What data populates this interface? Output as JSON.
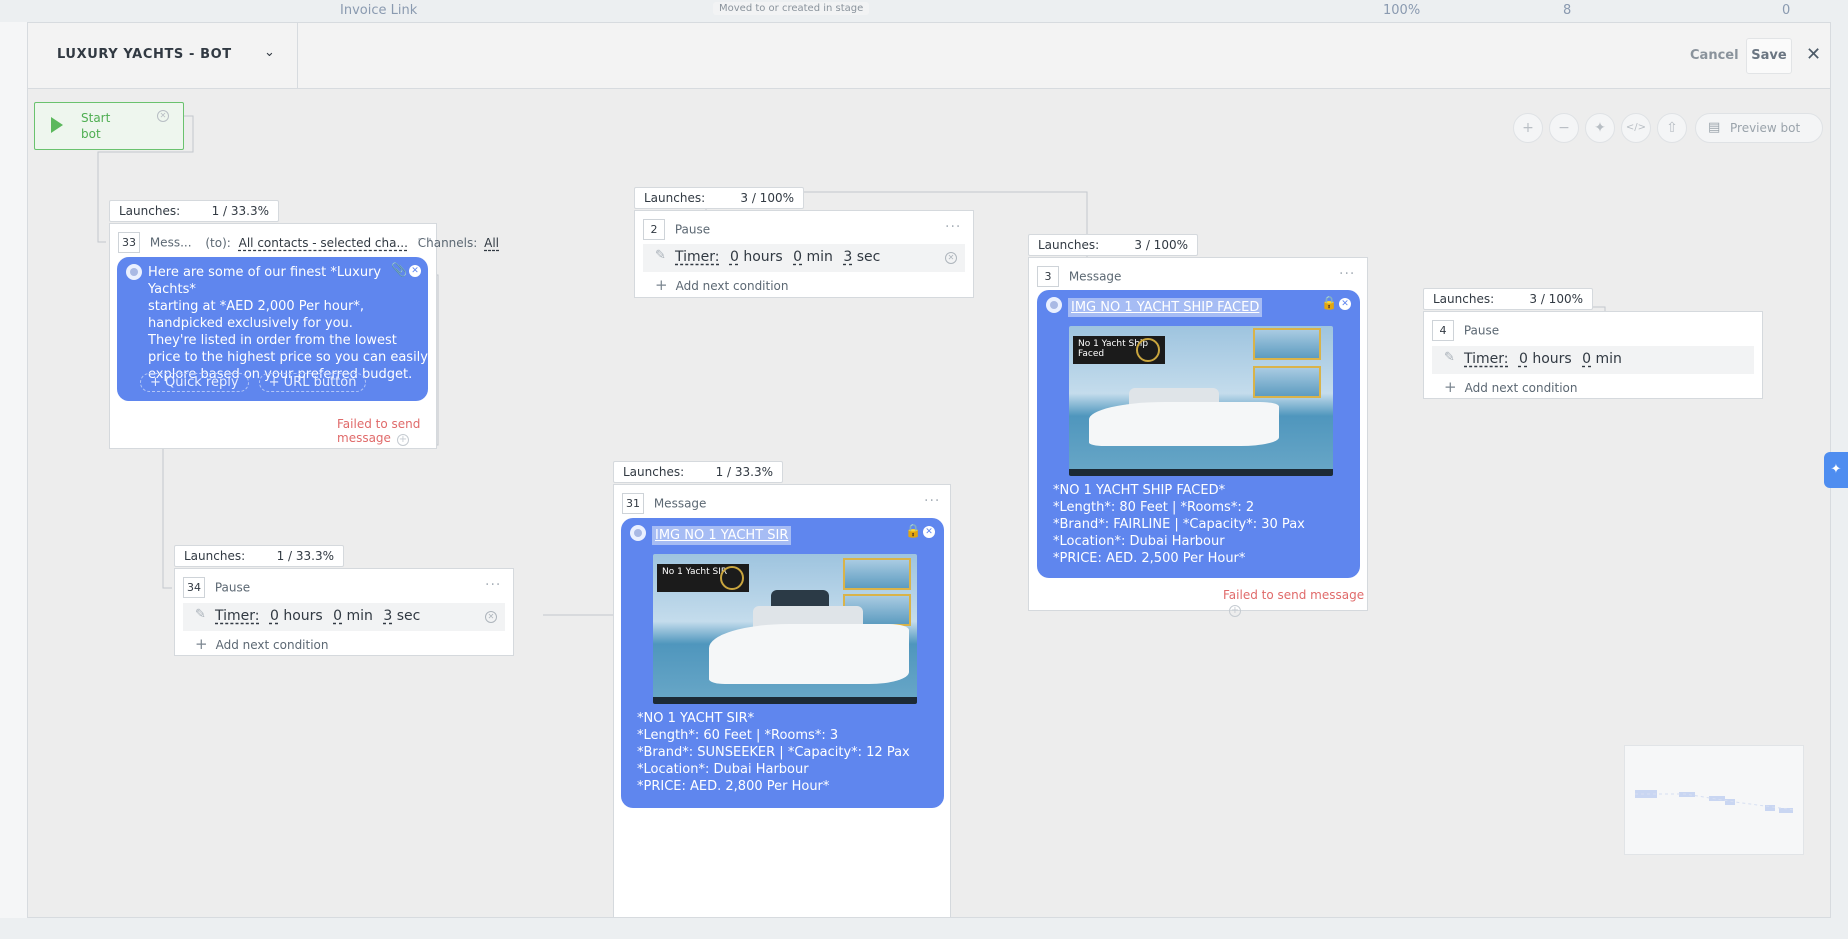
{
  "background": {
    "row_title": "Invoice Link",
    "row_badge": "Moved to or created in stage",
    "row_percent": "100%",
    "row_count_a": "8",
    "row_count_b": "0"
  },
  "header": {
    "title": "LUXURY YACHTS - BOT",
    "cancel_label": "Cancel",
    "save_label": "Save"
  },
  "toolbar": {
    "preview_label": "Preview bot"
  },
  "start": {
    "label_line1": "Start",
    "label_line2": "bot"
  },
  "nodes": {
    "n33": {
      "launches_label": "Launches:",
      "launches_value": "1 / 33.3%",
      "number": "33",
      "type": "Mess...",
      "to_label": "(to):",
      "to_value": "All contacts - selected cha...",
      "channels_label": "Channels:",
      "channels_value": "All",
      "text": "Here are some of our finest *Luxury Yachts*\nstarting at *AED 2,000 Per hour*,\nhandpicked exclusively for you.\nThey're listed in order from the lowest\nprice to the highest price so you can easily\nexplore based on your preferred budget.",
      "quick_reply": "+ Quick reply",
      "url_button": "+ URL button",
      "status": "Failed to send message"
    },
    "n34": {
      "launches_label": "Launches:",
      "launches_value": "1 / 33.3%",
      "number": "34",
      "type": "Pause",
      "timer_label": "Timer:",
      "hours": "0",
      "hours_label": "hours",
      "min": "0",
      "min_label": "min",
      "sec": "3",
      "sec_label": "sec",
      "add_condition": "Add next condition"
    },
    "n2": {
      "launches_label": "Launches:",
      "launches_value": "3 / 100%",
      "number": "2",
      "type": "Pause",
      "timer_label": "Timer:",
      "hours": "0",
      "hours_label": "hours",
      "min": "0",
      "min_label": "min",
      "sec": "3",
      "sec_label": "sec",
      "add_condition": "Add next condition"
    },
    "n31": {
      "launches_label": "Launches:",
      "launches_value": "1 / 33.3%",
      "number": "31",
      "type": "Message",
      "title": "IMG NO 1 YACHT SIR",
      "image_logo": "No 1 Yacht SIR",
      "description": "*NO 1 YACHT SIR*\n*Length*: 60 Feet | *Rooms*: 3\n*Brand*: SUNSEEKER | *Capacity*: 12 Pax\n*Location*: Dubai Harbour\n*PRICE: AED. 2,800 Per Hour*"
    },
    "n3": {
      "launches_label": "Launches:",
      "launches_value": "3 / 100%",
      "number": "3",
      "type": "Message",
      "title": "IMG NO 1 YACHT SHIP FACED",
      "image_logo": "No 1 Yacht Ship Faced",
      "description": "*NO 1 YACHT SHIP FACED*\n*Length*: 80 Feet | *Rooms*: 2\n*Brand*: FAIRLINE | *Capacity*: 30 Pax\n*Location*: Dubai Harbour\n*PRICE: AED. 2,500 Per Hour*",
      "status": "Failed to send message"
    },
    "n4": {
      "launches_label": "Launches:",
      "launches_value": "3 / 100%",
      "number": "4",
      "type": "Pause",
      "timer_label": "Timer:",
      "hours": "0",
      "hours_label": "hours",
      "min": "0",
      "min_label": "min",
      "add_condition": "Add next condition"
    }
  }
}
